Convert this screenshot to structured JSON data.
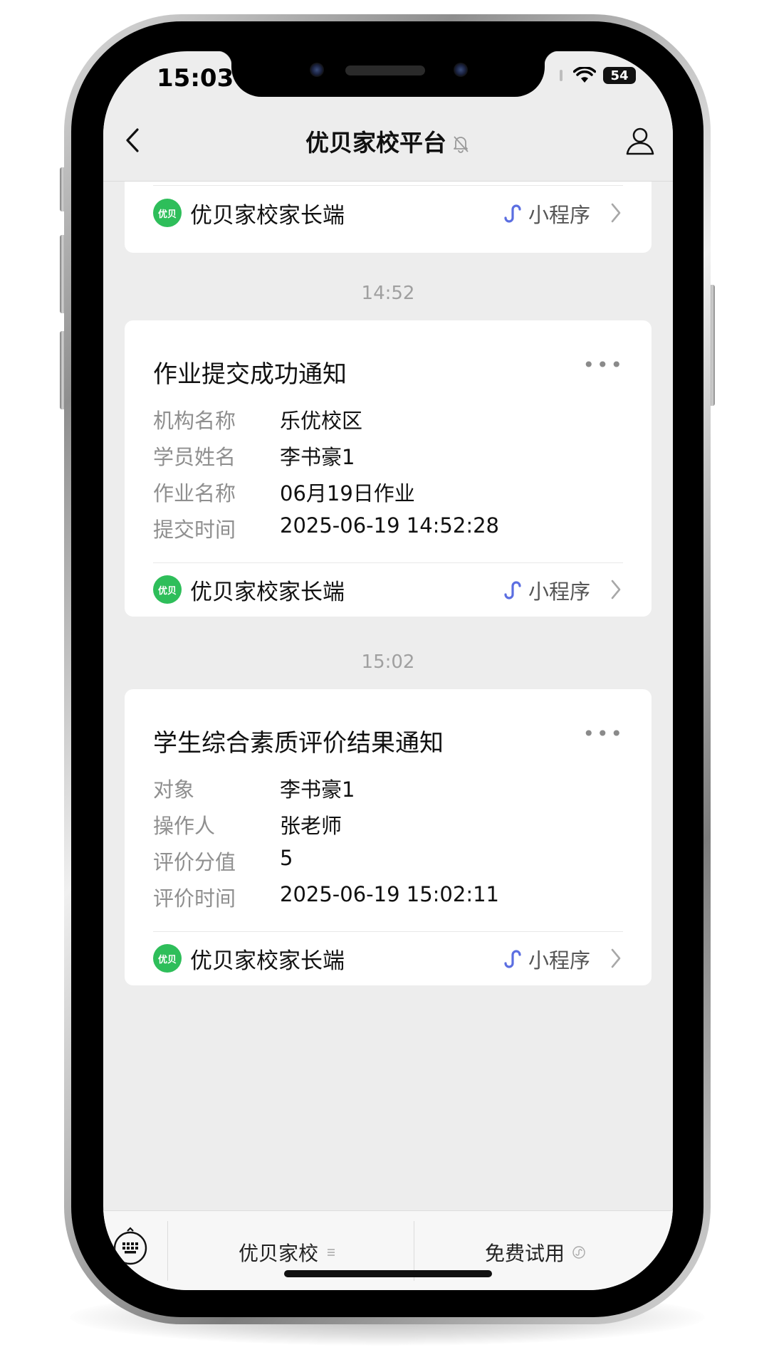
{
  "status_bar": {
    "time": "15:03",
    "battery": "54"
  },
  "nav": {
    "title": "优贝家校平台"
  },
  "cards": [
    {
      "mini_program": {
        "name": "优贝家校家长端",
        "logo_text": "优贝",
        "tag": "小程序"
      }
    },
    {
      "timestamp": "14:52",
      "title": "作业提交成功通知",
      "fields": [
        {
          "label": "机构名称",
          "value": "乐优校区"
        },
        {
          "label": "学员姓名",
          "value": "李书豪1"
        },
        {
          "label": "作业名称",
          "value": "06月19日作业"
        },
        {
          "label": "提交时间",
          "value": "2025-06-19 14:52:28"
        }
      ],
      "mini_program": {
        "name": "优贝家校家长端",
        "logo_text": "优贝",
        "tag": "小程序"
      }
    },
    {
      "timestamp": "15:02",
      "title": "学生综合素质评价结果通知",
      "fields": [
        {
          "label": "对象",
          "value": "李书豪1"
        },
        {
          "label": "操作人",
          "value": "张老师"
        },
        {
          "label": "评价分值",
          "value": "5"
        },
        {
          "label": "评价时间",
          "value": "2025-06-19 15:02:11"
        }
      ],
      "mini_program": {
        "name": "优贝家校家长端",
        "logo_text": "优贝",
        "tag": "小程序"
      }
    }
  ],
  "bottom_menu": {
    "items": [
      {
        "label": "优贝家校"
      },
      {
        "label": "免费试用"
      }
    ]
  },
  "colors": {
    "brand_green": "#2ebe5a",
    "mini_program_link": "#5b6ee1",
    "chat_bg": "#ededed"
  },
  "icons": [
    "back-arrow-icon",
    "mute-bell-icon",
    "profile-icon",
    "more-dots-icon",
    "mini-program-link-icon",
    "chevron-right-icon",
    "keyboard-icon",
    "menu-lines-icon",
    "mini-program-small-icon",
    "wifi-icon",
    "signal-icon",
    "battery-icon"
  ]
}
